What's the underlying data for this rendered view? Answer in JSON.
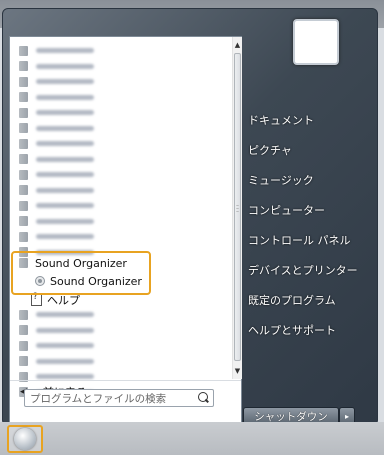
{
  "program_list": {
    "blurred_top_count": 14,
    "blurred_bottom_count": 6,
    "highlighted": {
      "folder_label": "Sound Organizer",
      "app_label": "Sound Organizer"
    },
    "help_label": "ヘルプ"
  },
  "back_label": "前に戻る",
  "search": {
    "placeholder": "プログラムとファイルの検索"
  },
  "right_pane": {
    "items": [
      {
        "label": "ドキュメント"
      },
      {
        "label": "ピクチャ"
      },
      {
        "label": "ミュージック"
      },
      {
        "label": "コンピューター"
      },
      {
        "label": "コントロール パネル"
      },
      {
        "label": "デバイスとプリンター"
      },
      {
        "label": "既定のプログラム"
      },
      {
        "label": "ヘルプとサポート"
      }
    ]
  },
  "shutdown": {
    "label": "シャットダウン",
    "arrow": "▸"
  },
  "icons": {
    "start": "windows-orb-icon",
    "folder": "folder-icon",
    "speaker": "sound-organizer-icon",
    "help": "help-icon",
    "search": "search-icon"
  },
  "colors": {
    "highlight": "#e8a321"
  }
}
